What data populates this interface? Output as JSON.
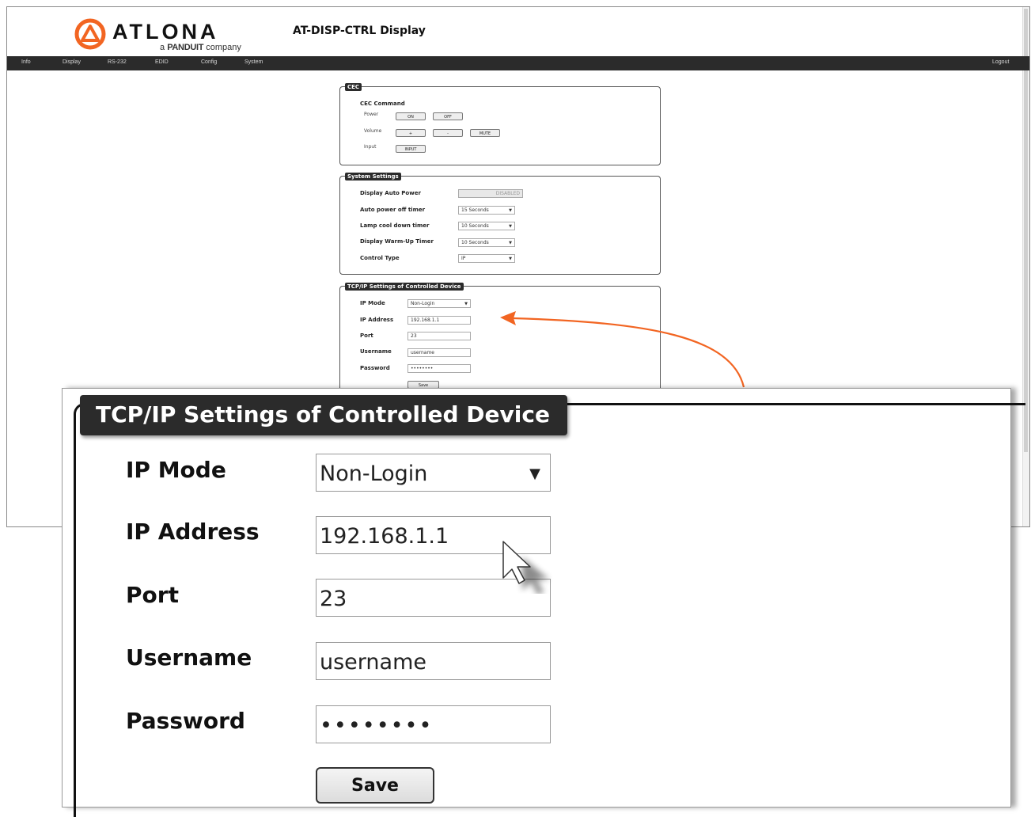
{
  "brand": {
    "name": "ATLONA",
    "sub_prefix": "a ",
    "sub_brand": "PANDUIT",
    "sub_suffix": " company",
    "accent": "#f26522"
  },
  "header": {
    "title": "AT-DISP-CTRL  Display"
  },
  "nav": {
    "items": [
      "Info",
      "Display",
      "RS-232",
      "EDID",
      "Config",
      "System"
    ],
    "logout": "Logout"
  },
  "cec": {
    "legend": "CEC",
    "heading": "CEC Command",
    "power_label": "Power",
    "power_on": "ON",
    "power_off": "OFF",
    "volume_label": "Volume",
    "vol_up": "+",
    "vol_down": "-",
    "mute": "MUTE",
    "input_label": "Input",
    "input_btn": "INPUT"
  },
  "system": {
    "legend": "System Settings",
    "rows": [
      {
        "label": "Display Auto Power",
        "value": "DISABLED"
      },
      {
        "label": "Auto power off timer",
        "value": "15 Seconds"
      },
      {
        "label": "Lamp cool down timer",
        "value": "10 Seconds"
      },
      {
        "label": "Display Warm-Up Timer",
        "value": "10 Seconds"
      },
      {
        "label": "Control Type",
        "value": "IP"
      }
    ]
  },
  "tcpip": {
    "legend": "TCP/IP Settings of Controlled Device",
    "ip_mode_label": "IP Mode",
    "ip_mode_value": "Non-Login",
    "ip_address_label": "IP Address",
    "ip_address_value": "192.168.1.1",
    "port_label": "Port",
    "port_value": "23",
    "username_label": "Username",
    "username_value": "username",
    "password_label": "Password",
    "password_value": "••••••••",
    "save": "Save"
  },
  "colors": {
    "nav_bg": "#2b2b2b",
    "arrow": "#f26522"
  }
}
